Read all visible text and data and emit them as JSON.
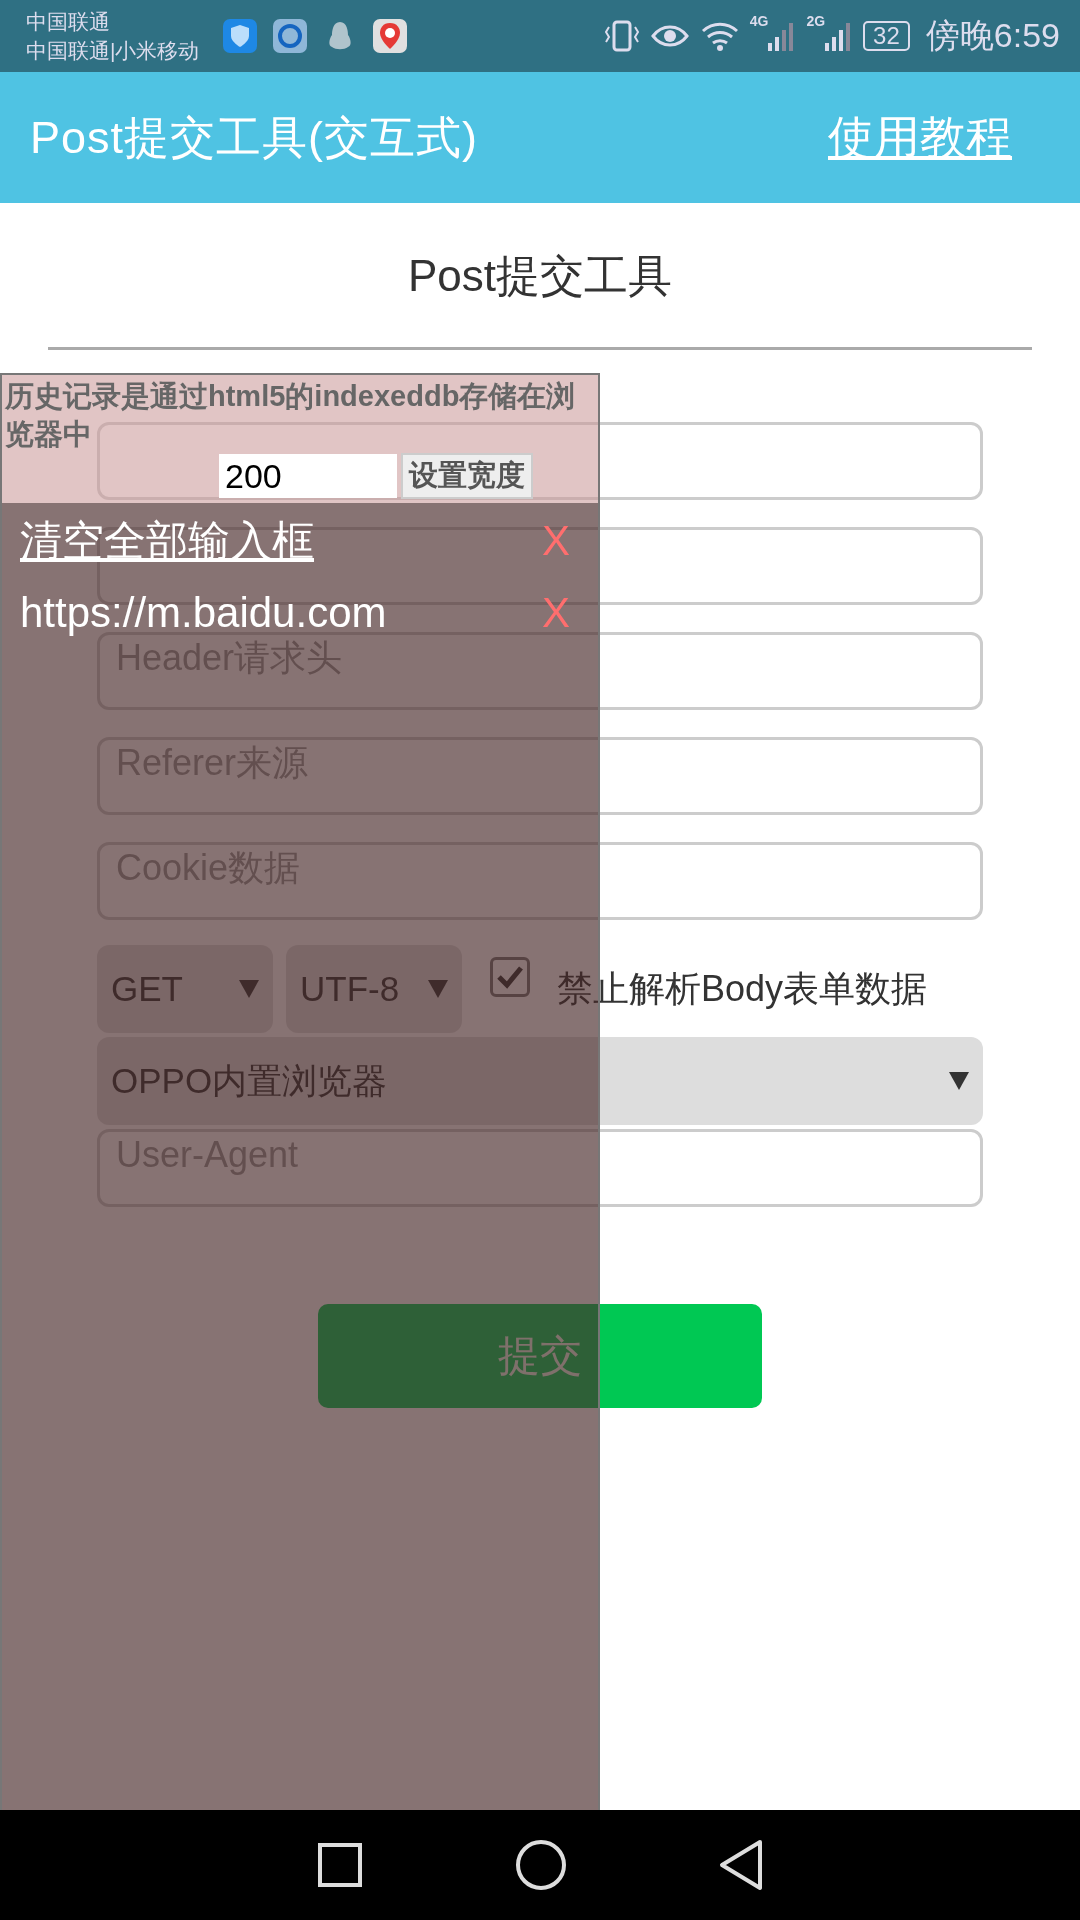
{
  "status_bar": {
    "carrier_1": "中国联通",
    "carrier_2": "中国联通|小米移动",
    "network_1": "4G",
    "network_2": "2G",
    "battery": "32",
    "time": "傍晚6:59"
  },
  "app_bar": {
    "title": "Post提交工具(交互式)",
    "link": "使用教程"
  },
  "page_title": "Post提交工具",
  "fields": [
    {
      "placeholder": "Header请求头"
    },
    {
      "placeholder": "Referer来源"
    },
    {
      "placeholder": "Cookie数据"
    }
  ],
  "method_select": {
    "value": "GET"
  },
  "charset_select": {
    "value": "UTF-8"
  },
  "checkbox": {
    "label": "禁止解析Body表单数据",
    "checked": true
  },
  "ua_select": {
    "value": "OPPO内置浏览器"
  },
  "ua_field": {
    "placeholder": "User-Agent"
  },
  "submit": "提交",
  "history_panel": {
    "note": "历史记录是通过html5的indexeddb存储在浏览器中",
    "width_input": "200",
    "width_button": "设置宽度",
    "items": [
      {
        "kind": "action",
        "text": "清空全部输入框",
        "delete": "X"
      },
      {
        "kind": "entry",
        "text": "https://m.baidu.com",
        "delete": "X"
      }
    ]
  }
}
